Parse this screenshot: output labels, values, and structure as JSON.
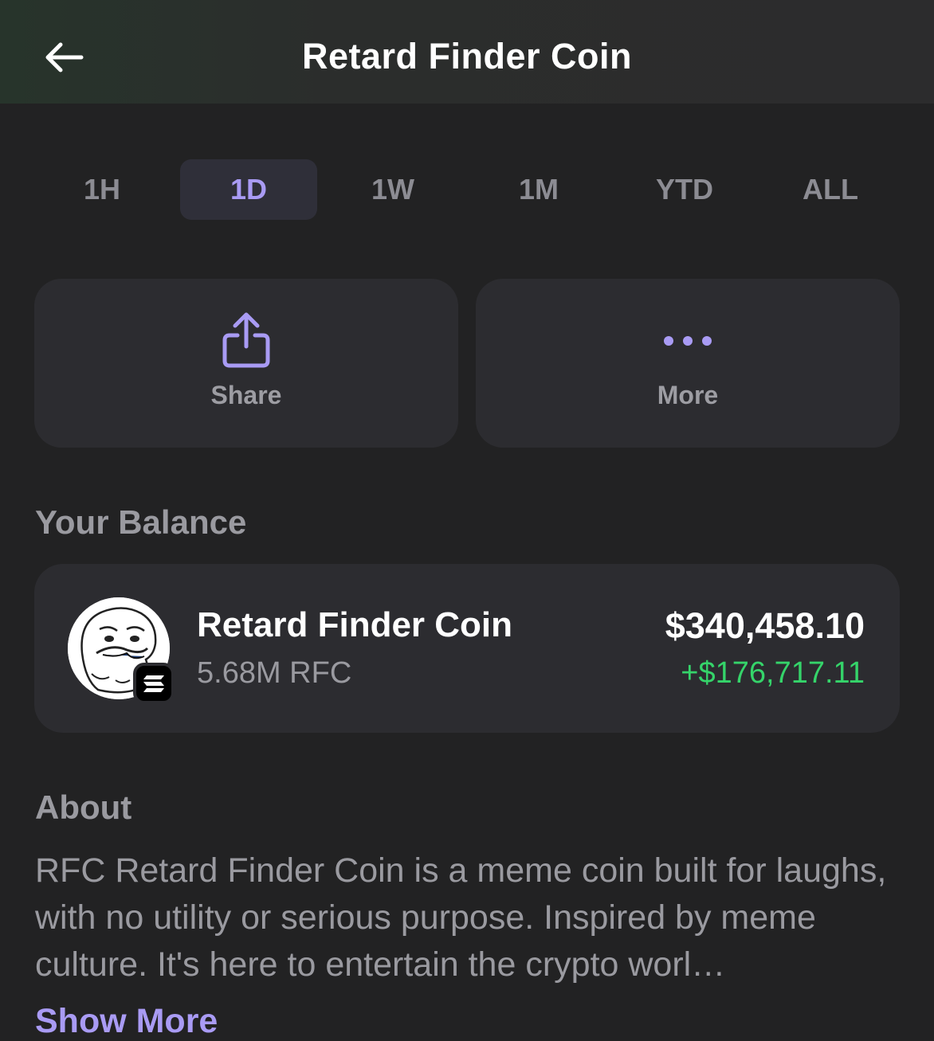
{
  "header": {
    "title": "Retard Finder Coin",
    "back_icon": "arrow-left-icon"
  },
  "timeframes": {
    "items": [
      "1H",
      "1D",
      "1W",
      "1M",
      "YTD",
      "ALL"
    ],
    "selected": "1D"
  },
  "actions": {
    "share_label": "Share",
    "share_icon": "share-icon",
    "more_label": "More",
    "more_icon": "more-dots-icon"
  },
  "balance": {
    "section_title": "Your Balance",
    "coin_name": "Retard Finder Coin",
    "amount": "5.68M RFC",
    "usd_value": "$340,458.10",
    "change": "+$176,717.11",
    "avatar_icon": "meme-face-avatar",
    "chain_icon": "solana-icon"
  },
  "about": {
    "section_title": "About",
    "text": "RFC Retard Finder Coin is a meme coin built for laughs, with no utility or serious purpose. Inspired by meme culture. It's here to entertain the crypto worl…",
    "show_more_label": "Show More"
  },
  "colors": {
    "background": "#222223",
    "card": "#2c2c30",
    "accent": "#a99bf4",
    "positive": "#35d46a"
  }
}
